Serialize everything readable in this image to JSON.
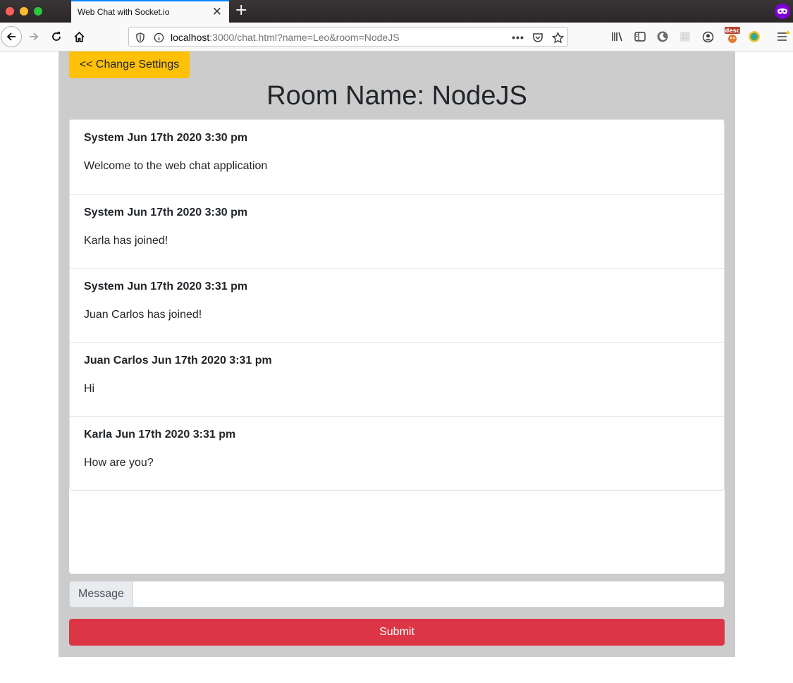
{
  "browser": {
    "tab_title": "Web Chat with Socket.io",
    "tab_close": "✕",
    "new_tab": "+",
    "url_host": "localhost",
    "url_rest": ":3000/chat.html?name=Leo&room=NodeJS",
    "page_actions": "•••"
  },
  "page": {
    "change_settings_label": "<< Change Settings",
    "room_title": "Room Name: NodeJS",
    "messages": [
      {
        "header": "System Jun 17th 2020 3:30 pm",
        "text": "Welcome to the web chat application"
      },
      {
        "header": "System Jun 17th 2020 3:30 pm",
        "text": "Karla has joined!"
      },
      {
        "header": "System Jun 17th 2020 3:31 pm",
        "text": "Juan Carlos has joined!"
      },
      {
        "header": "Juan Carlos Jun 17th 2020 3:31 pm",
        "text": "Hi"
      },
      {
        "header": "Karla Jun 17th 2020 3:31 pm",
        "text": "How are you?"
      }
    ],
    "message_label": "Message",
    "message_value": "",
    "submit_label": "Submit"
  },
  "colors": {
    "change_button": "#ffc107",
    "submit_button": "#dc3545",
    "page_background": "#cccccc"
  }
}
